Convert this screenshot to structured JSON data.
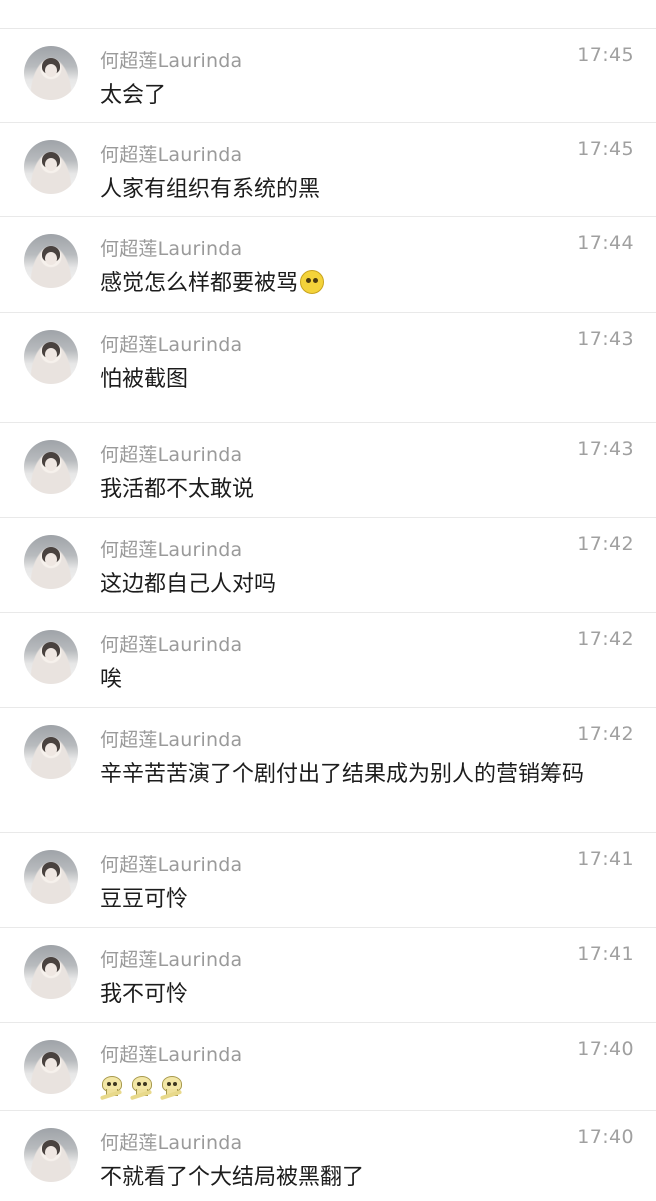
{
  "chat": {
    "messages": [
      {
        "name": "何超莲Laurinda",
        "time": "17:45",
        "text": "太会了"
      },
      {
        "name": "何超莲Laurinda",
        "time": "17:45",
        "text": "人家有组织有系统的黑"
      },
      {
        "name": "何超莲Laurinda",
        "time": "17:44",
        "text": "感觉怎么样都要被骂",
        "emoji": "pleading-face-icon"
      },
      {
        "name": "何超莲Laurinda",
        "time": "17:43",
        "text": "怕被截图"
      },
      {
        "name": "何超莲Laurinda",
        "time": "17:43",
        "text": "我活都不太敢说"
      },
      {
        "name": "何超莲Laurinda",
        "time": "17:42",
        "text": "这边都自己人对吗"
      },
      {
        "name": "何超莲Laurinda",
        "time": "17:42",
        "text": "唉"
      },
      {
        "name": "何超莲Laurinda",
        "time": "17:42",
        "text": "辛辛苦苦演了个剧付出了结果成为别人的营销筹码"
      },
      {
        "name": "何超莲Laurinda",
        "time": "17:41",
        "text": "豆豆可怜"
      },
      {
        "name": "何超莲Laurinda",
        "time": "17:41",
        "text": "我不可怜"
      },
      {
        "name": "何超莲Laurinda",
        "time": "17:40",
        "text": "",
        "emoji": "skull-icon x3"
      },
      {
        "name": "何超莲Laurinda",
        "time": "17:40",
        "text": "不就看了个大结局被黑翻了"
      }
    ]
  }
}
